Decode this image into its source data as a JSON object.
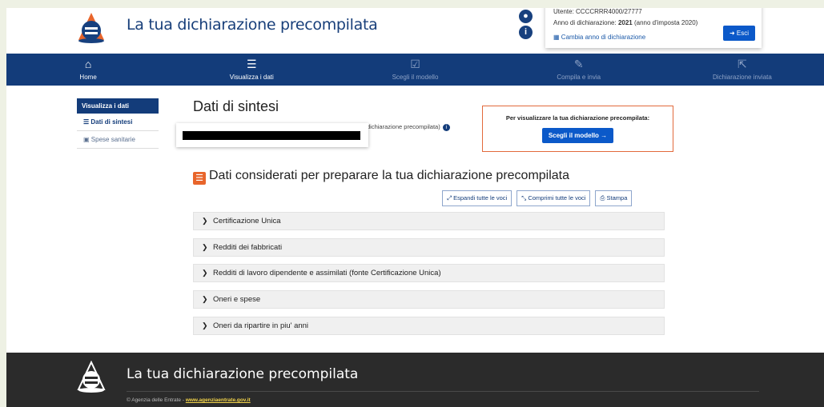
{
  "header": {
    "app_title": "La tua dichiarazione precompilata",
    "user_line": "Utente: CCCCRRR4000/27777",
    "year_label": "Anno di dichiarazione:",
    "year_value": "2021",
    "year_note": "(anno d'imposta 2020)",
    "change_year": "Cambia anno di dichiarazione",
    "logout": "Esci"
  },
  "nav": [
    {
      "label": "Home",
      "icon": "⌂"
    },
    {
      "label": "Visualizza i dati",
      "icon": "☰"
    },
    {
      "label": "Scegli il modello",
      "icon": "☑"
    },
    {
      "label": "Compila e invia",
      "icon": "✎"
    },
    {
      "label": "Dichiarazione inviata",
      "icon": "⇱"
    }
  ],
  "sidebar": {
    "header": "Visualizza i dati",
    "items": [
      {
        "label": "Dati di sintesi",
        "icon": "☰"
      },
      {
        "label": "Spese sanitarie",
        "icon": "▣"
      }
    ]
  },
  "main": {
    "title": "Dati di sintesi",
    "subtitle": "dichiarazione precompilata)",
    "cta_text": "Per visualizzare la tua dichiarazione precompilata:",
    "cta_button": "Scegli il modello →",
    "section_title": "Dati considerati per preparare la tua dichiarazione precompilata",
    "tools": [
      "Espandi tutte le voci",
      "Comprimi tutte le voci",
      "Stampa"
    ],
    "accordion": [
      "Certificazione Unica",
      "Redditi dei fabbricati",
      "Redditi di lavoro dipendente e assimilati (fonte Certificazione Unica)",
      "Oneri e spese",
      "Oneri da ripartire in piu' anni"
    ]
  },
  "footer": {
    "title": "La tua dichiarazione precompilata",
    "copyright": "© Agenzia delle Entrate - ",
    "link": "www.agenziaentrate.gov.it"
  },
  "colors": {
    "primary": "#133c7a",
    "accent": "#e8652b",
    "button": "#0b59c9"
  }
}
